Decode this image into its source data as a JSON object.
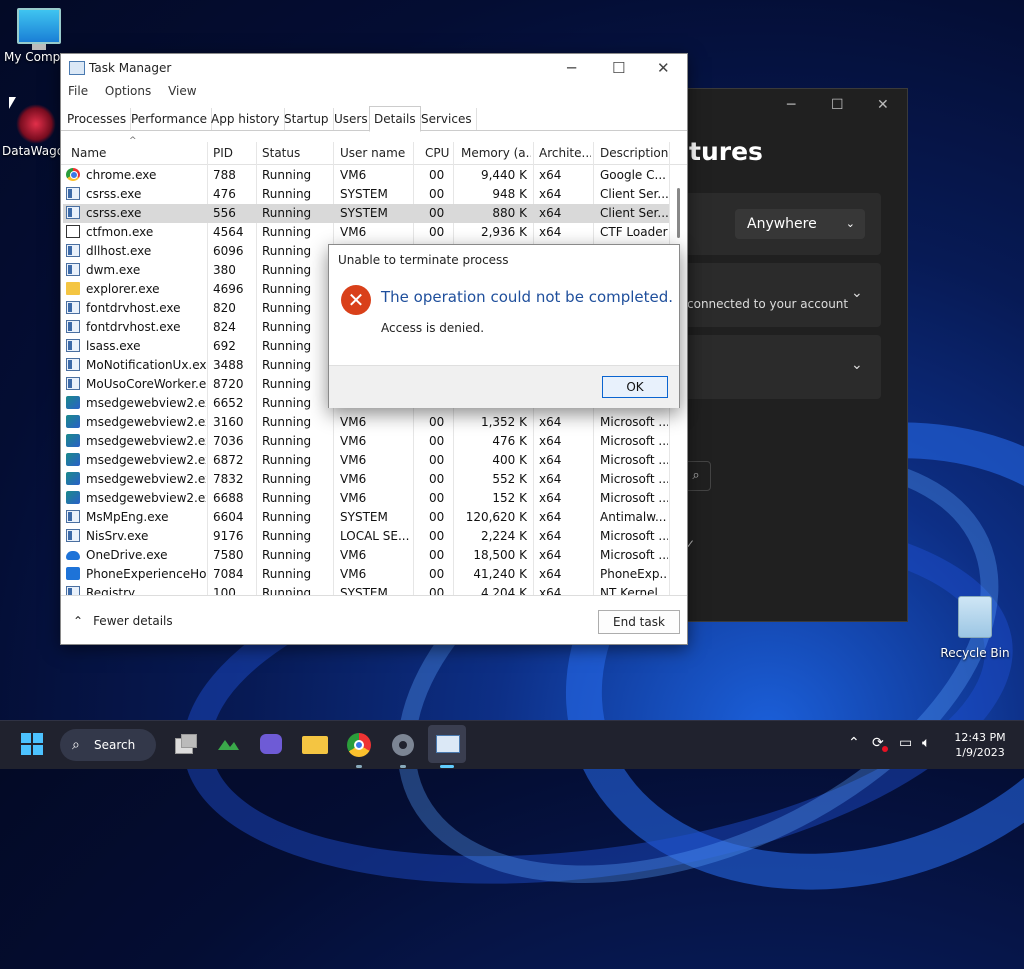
{
  "desktop": {
    "icons": [
      {
        "label": "My Compu"
      },
      {
        "label": "DataWagon"
      },
      {
        "label": "Recycle Bin"
      }
    ]
  },
  "background_window": {
    "heading": "tures",
    "dropdown_value": "Anywhere",
    "card_text": "connected to your account"
  },
  "task_manager": {
    "title": "Task Manager",
    "menu": [
      "File",
      "Options",
      "View"
    ],
    "tabs": [
      "Processes",
      "Performance",
      "App history",
      "Startup",
      "Users",
      "Details",
      "Services"
    ],
    "active_tab": "Details",
    "columns": [
      "Name",
      "PID",
      "Status",
      "User name",
      "CPU",
      "Memory (a...",
      "Archite...",
      "Description"
    ],
    "rows": [
      {
        "icon": "chrome",
        "name": "chrome.exe",
        "pid": "788",
        "status": "Running",
        "user": "VM6",
        "cpu": "00",
        "mem": "9,440 K",
        "arch": "x64",
        "desc": "Google C..."
      },
      {
        "icon": "app",
        "name": "csrss.exe",
        "pid": "476",
        "status": "Running",
        "user": "SYSTEM",
        "cpu": "00",
        "mem": "948 K",
        "arch": "x64",
        "desc": "Client Ser..."
      },
      {
        "icon": "app",
        "name": "csrss.exe",
        "pid": "556",
        "status": "Running",
        "user": "SYSTEM",
        "cpu": "00",
        "mem": "880 K",
        "arch": "x64",
        "desc": "Client Ser...",
        "selected": true
      },
      {
        "icon": "pen",
        "name": "ctfmon.exe",
        "pid": "4564",
        "status": "Running",
        "user": "VM6",
        "cpu": "00",
        "mem": "2,936 K",
        "arch": "x64",
        "desc": "CTF Loader"
      },
      {
        "icon": "app",
        "name": "dllhost.exe",
        "pid": "6096",
        "status": "Running",
        "user": "",
        "cpu": "",
        "mem": "",
        "arch": "",
        "desc": ""
      },
      {
        "icon": "app",
        "name": "dwm.exe",
        "pid": "380",
        "status": "Running",
        "user": "",
        "cpu": "",
        "mem": "",
        "arch": "",
        "desc": ""
      },
      {
        "icon": "folder",
        "name": "explorer.exe",
        "pid": "4696",
        "status": "Running",
        "user": "",
        "cpu": "",
        "mem": "",
        "arch": "",
        "desc": ""
      },
      {
        "icon": "app",
        "name": "fontdrvhost.exe",
        "pid": "820",
        "status": "Running",
        "user": "",
        "cpu": "",
        "mem": "",
        "arch": "",
        "desc": ""
      },
      {
        "icon": "app",
        "name": "fontdrvhost.exe",
        "pid": "824",
        "status": "Running",
        "user": "",
        "cpu": "",
        "mem": "",
        "arch": "",
        "desc": ""
      },
      {
        "icon": "app",
        "name": "lsass.exe",
        "pid": "692",
        "status": "Running",
        "user": "",
        "cpu": "",
        "mem": "",
        "arch": "",
        "desc": ""
      },
      {
        "icon": "app",
        "name": "MoNotificationUx.exe",
        "pid": "3488",
        "status": "Running",
        "user": "",
        "cpu": "",
        "mem": "",
        "arch": "",
        "desc": ""
      },
      {
        "icon": "app",
        "name": "MoUsoCoreWorker.e...",
        "pid": "8720",
        "status": "Running",
        "user": "",
        "cpu": "",
        "mem": "",
        "arch": "",
        "desc": ""
      },
      {
        "icon": "edge",
        "name": "msedgewebview2.exe",
        "pid": "6652",
        "status": "Running",
        "user": "",
        "cpu": "",
        "mem": "",
        "arch": "",
        "desc": ""
      },
      {
        "icon": "edge",
        "name": "msedgewebview2.exe",
        "pid": "3160",
        "status": "Running",
        "user": "VM6",
        "cpu": "00",
        "mem": "1,352 K",
        "arch": "x64",
        "desc": "Microsoft ..."
      },
      {
        "icon": "edge",
        "name": "msedgewebview2.exe",
        "pid": "7036",
        "status": "Running",
        "user": "VM6",
        "cpu": "00",
        "mem": "476 K",
        "arch": "x64",
        "desc": "Microsoft ..."
      },
      {
        "icon": "edge",
        "name": "msedgewebview2.exe",
        "pid": "6872",
        "status": "Running",
        "user": "VM6",
        "cpu": "00",
        "mem": "400 K",
        "arch": "x64",
        "desc": "Microsoft ..."
      },
      {
        "icon": "edge",
        "name": "msedgewebview2.exe",
        "pid": "7832",
        "status": "Running",
        "user": "VM6",
        "cpu": "00",
        "mem": "552 K",
        "arch": "x64",
        "desc": "Microsoft ..."
      },
      {
        "icon": "edge",
        "name": "msedgewebview2.exe",
        "pid": "6688",
        "status": "Running",
        "user": "VM6",
        "cpu": "00",
        "mem": "152 K",
        "arch": "x64",
        "desc": "Microsoft ..."
      },
      {
        "icon": "app",
        "name": "MsMpEng.exe",
        "pid": "6604",
        "status": "Running",
        "user": "SYSTEM",
        "cpu": "00",
        "mem": "120,620 K",
        "arch": "x64",
        "desc": "Antimalw..."
      },
      {
        "icon": "app",
        "name": "NisSrv.exe",
        "pid": "9176",
        "status": "Running",
        "user": "LOCAL SE...",
        "cpu": "00",
        "mem": "2,224 K",
        "arch": "x64",
        "desc": "Microsoft ..."
      },
      {
        "icon": "cloud",
        "name": "OneDrive.exe",
        "pid": "7580",
        "status": "Running",
        "user": "VM6",
        "cpu": "00",
        "mem": "18,500 K",
        "arch": "x64",
        "desc": "Microsoft ..."
      },
      {
        "icon": "phone",
        "name": "PhoneExperienceHo...",
        "pid": "7084",
        "status": "Running",
        "user": "VM6",
        "cpu": "00",
        "mem": "41,240 K",
        "arch": "x64",
        "desc": "PhoneExp..."
      },
      {
        "icon": "app",
        "name": "Registry",
        "pid": "100",
        "status": "Running",
        "user": "SYSTEM",
        "cpu": "00",
        "mem": "4,204 K",
        "arch": "x64",
        "desc": "NT Kernel ..."
      }
    ],
    "fewer_details": "Fewer details",
    "end_task": "End task"
  },
  "dialog": {
    "title": "Unable to terminate process",
    "main": "The operation could not be completed.",
    "sub": "Access is denied.",
    "ok": "OK"
  },
  "taskbar": {
    "search_label": "Search",
    "time": "12:43 PM",
    "date": "1/9/2023"
  },
  "colors": {
    "accent": "#0a64d0",
    "error": "#d9401a",
    "dialog_text": "#1f4f9c"
  }
}
